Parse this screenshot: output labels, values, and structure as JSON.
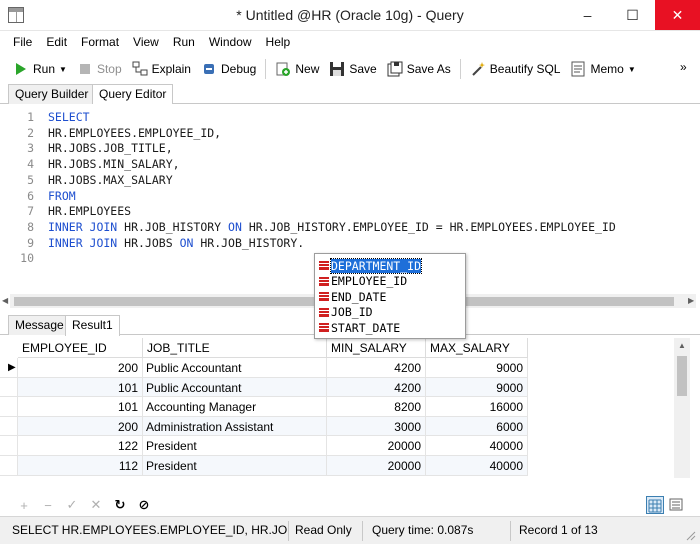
{
  "window": {
    "title": "* Untitled @HR (Oracle 10g) - Query",
    "minimize": "–",
    "maximize": "☐",
    "close": "✕"
  },
  "menu": [
    "File",
    "Edit",
    "Format",
    "View",
    "Run",
    "Window",
    "Help"
  ],
  "toolbar": {
    "run": "Run",
    "stop": "Stop",
    "explain": "Explain",
    "debug": "Debug",
    "new": "New",
    "save": "Save",
    "save_as": "Save As",
    "beautify": "Beautify SQL",
    "memo": "Memo"
  },
  "editor_tabs": [
    "Query Builder",
    "Query Editor"
  ],
  "editor": {
    "line_numbers": [
      "1",
      "2",
      "3",
      "4",
      "5",
      "6",
      "7",
      "8",
      "9",
      "10"
    ],
    "lines": [
      [
        {
          "t": "SELECT",
          "k": true
        }
      ],
      [
        {
          "t": "HR.EMPLOYEES.EMPLOYEE_ID,",
          "k": false
        }
      ],
      [
        {
          "t": "HR.JOBS.JOB_TITLE,",
          "k": false
        }
      ],
      [
        {
          "t": "HR.JOBS.MIN_SALARY,",
          "k": false
        }
      ],
      [
        {
          "t": "HR.JOBS.MAX_SALARY",
          "k": false
        }
      ],
      [
        {
          "t": "FROM",
          "k": true
        }
      ],
      [
        {
          "t": "HR.EMPLOYEES",
          "k": false
        }
      ],
      [
        {
          "t": "INNER JOIN",
          "k": true
        },
        {
          "t": " HR.JOB_HISTORY ",
          "k": false
        },
        {
          "t": "ON",
          "k": true
        },
        {
          "t": " HR.JOB_HISTORY.EMPLOYEE_ID = HR.EMPLOYEES.EMPLOYEE_ID",
          "k": false
        }
      ],
      [
        {
          "t": "INNER JOIN",
          "k": true
        },
        {
          "t": " HR.JOBS ",
          "k": false
        },
        {
          "t": "ON",
          "k": true
        },
        {
          "t": " HR.JOB_HISTORY.",
          "k": false
        }
      ],
      []
    ]
  },
  "autocomplete": {
    "items": [
      "DEPARTMENT_ID",
      "EMPLOYEE_ID",
      "END_DATE",
      "JOB_ID",
      "START_DATE"
    ],
    "selected_index": 0
  },
  "result_tabs": [
    "Message",
    "Result1"
  ],
  "grid": {
    "columns": [
      "EMPLOYEE_ID",
      "JOB_TITLE",
      "MIN_SALARY",
      "MAX_SALARY"
    ],
    "rows": [
      [
        "200",
        "Public Accountant",
        "4200",
        "9000"
      ],
      [
        "101",
        "Public Accountant",
        "4200",
        "9000"
      ],
      [
        "101",
        "Accounting Manager",
        "8200",
        "16000"
      ],
      [
        "200",
        "Administration Assistant",
        "3000",
        "6000"
      ],
      [
        "122",
        "President",
        "20000",
        "40000"
      ],
      [
        "112",
        "President",
        "20000",
        "40000"
      ]
    ],
    "current_row": 0
  },
  "grid_toolbar": [
    "+",
    "−",
    "✓",
    "✕",
    "↻",
    "⊘"
  ],
  "status": {
    "sql": "SELECT HR.EMPLOYEES.EMPLOYEE_ID, HR.JOBS.JOB_",
    "mode": "Read Only",
    "query_time": "Query time: 0.087s",
    "record": "Record 1 of 13"
  },
  "colors": {
    "keyword": "#1e4fcf",
    "selection": "#1e6fd9",
    "close_button": "#e81123"
  }
}
